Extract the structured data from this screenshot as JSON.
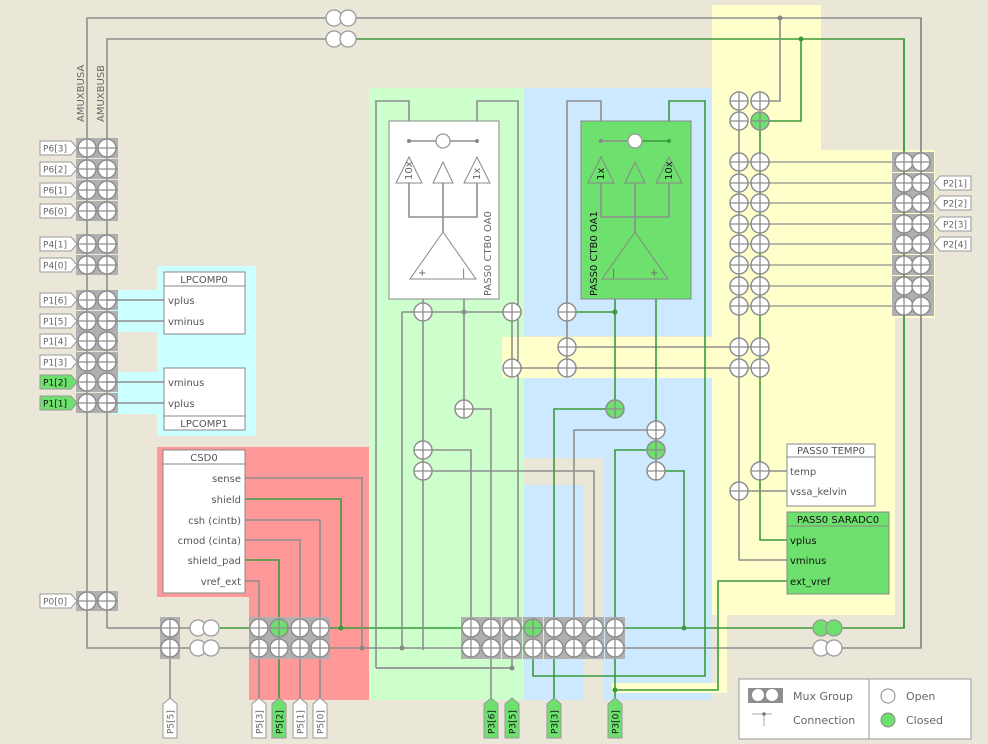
{
  "buses": {
    "a_label": "AMUXBUSA",
    "b_label": "AMUXBUSB"
  },
  "colors": {
    "background": "#ebe7d8",
    "wire": "#8e8e8e",
    "wire_active": "#3a9a3a",
    "switch_closed": "#6ee06e",
    "lpcomp_region": "#ccffff",
    "csd_region": "#ff9999",
    "ctb_oa0_region": "#ccffcc",
    "ctb_oa1_region": "#cce9ff",
    "sar_region": "#ffffcc",
    "active_block": "#6ee06e"
  },
  "left_pins": [
    {
      "label": "P6[3]",
      "active": false
    },
    {
      "label": "P6[2]",
      "active": false
    },
    {
      "label": "P6[1]",
      "active": false
    },
    {
      "label": "P6[0]",
      "active": false
    },
    {
      "label": "P4[1]",
      "active": false
    },
    {
      "label": "P4[0]",
      "active": false
    },
    {
      "label": "P1[6]",
      "active": false
    },
    {
      "label": "P1[5]",
      "active": false
    },
    {
      "label": "P1[4]",
      "active": false
    },
    {
      "label": "P1[3]",
      "active": false
    },
    {
      "label": "P1[2]",
      "active": true
    },
    {
      "label": "P1[1]",
      "active": true
    },
    {
      "label": "P0[0]",
      "active": false
    }
  ],
  "right_pins": [
    {
      "label": "P2[1]"
    },
    {
      "label": "P2[2]"
    },
    {
      "label": "P2[3]"
    },
    {
      "label": "P2[4]"
    }
  ],
  "bottom_pins": [
    {
      "label": "P5[5]",
      "active": false
    },
    {
      "label": "P5[3]",
      "active": false
    },
    {
      "label": "P5[2]",
      "active": true
    },
    {
      "label": "P5[1]",
      "active": false
    },
    {
      "label": "P5[0]",
      "active": false
    },
    {
      "label": "P3[6]",
      "active": true
    },
    {
      "label": "P3[5]",
      "active": true
    },
    {
      "label": "P3[3]",
      "active": true
    },
    {
      "label": "P3[0]",
      "active": true
    }
  ],
  "lpcomp0": {
    "title": "LPCOMP0",
    "ports": [
      "vplus",
      "vminus"
    ]
  },
  "lpcomp1": {
    "title": "LPCOMP1",
    "ports": [
      "vminus",
      "vplus"
    ]
  },
  "csd0": {
    "title": "CSD0",
    "ports": [
      "sense",
      "shield",
      "csh (cintb)",
      "cmod (cinta)",
      "shield_pad",
      "vref_ext"
    ]
  },
  "ctb_oa0": {
    "title": "PASS0 CTB0 OA0",
    "buffers": [
      "10x",
      "1x"
    ],
    "active": false
  },
  "ctb_oa1": {
    "title": "PASS0 CTB0 OA1",
    "buffers": [
      "1x",
      "10x"
    ],
    "active": true
  },
  "temp0": {
    "title": "PASS0 TEMP0",
    "ports": [
      "temp",
      "vssa_kelvin"
    ]
  },
  "saradc0": {
    "title": "PASS0 SARADC0",
    "ports": [
      "vplus",
      "vminus",
      "ext_vref"
    ],
    "active": true
  },
  "legend": {
    "mux_group": "Mux Group",
    "connection": "Connection",
    "open": "Open",
    "closed": "Closed"
  }
}
